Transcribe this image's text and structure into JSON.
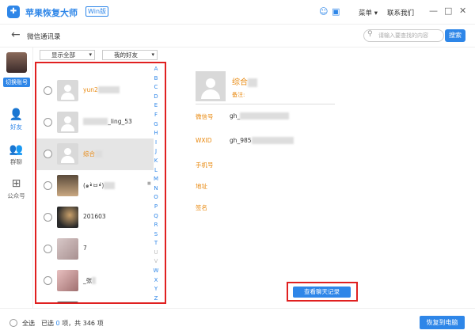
{
  "app": {
    "title": "苹果恢复大师",
    "edition": "Win版",
    "logo_glyph": "✚"
  },
  "titlebar": {
    "menu_label": "菜单",
    "menu_arrow": "▾",
    "contact_label": "联系我们",
    "min": "—",
    "max": "□",
    "close": "✕"
  },
  "nav": {
    "back": "←",
    "title": "微信通讯录"
  },
  "search": {
    "placeholder": "请输入要查找的内容",
    "button": "搜索"
  },
  "sidebar": {
    "switch_label": "切换账号",
    "items": [
      {
        "icon": "person-icon",
        "glyph": "👤",
        "label": "好友",
        "active": true
      },
      {
        "icon": "group-icon",
        "glyph": "👥",
        "label": "群聊",
        "active": false
      },
      {
        "icon": "grid-icon",
        "glyph": "⊞",
        "label": "公众号",
        "active": false
      }
    ]
  },
  "filters": {
    "show_all": "显示全部",
    "my_friends": "我的好友",
    "arrow": "▾"
  },
  "contacts": [
    {
      "name_prefix": "yun2",
      "name_hidden": "1xxxxx",
      "style": "orange"
    },
    {
      "name_prefix": "",
      "name_hidden": "xxxxxxx",
      "name_suffix": "_ling_53",
      "style": "normal"
    },
    {
      "name_prefix": "综合",
      "name_hidden": "xx",
      "style": "orange",
      "selected": true
    },
    {
      "name_prefix": "(๑•̀ㅂ•́)",
      "name_hidden": "xxx",
      "name_suffix": "",
      "style": "normal",
      "badge": "■"
    },
    {
      "name_prefix": "201603",
      "name_hidden": "",
      "style": "normal"
    },
    {
      "name_prefix": "7",
      "name_hidden": "",
      "style": "normal"
    },
    {
      "name_prefix": "_张",
      "name_hidden": "x",
      "style": "normal"
    }
  ],
  "alphabet": [
    "A",
    "B",
    "C",
    "D",
    "E",
    "F",
    "G",
    "H",
    "I",
    "J",
    "K",
    "L",
    "M",
    "N",
    "O",
    "P",
    "Q",
    "R",
    "S",
    "T",
    "U",
    "V",
    "W",
    "X",
    "Y",
    "Z"
  ],
  "alphabet_dim": [
    "U",
    "V"
  ],
  "detail": {
    "name_prefix": "综合",
    "remark_label": "备注:",
    "fields": [
      {
        "label": "微信号",
        "value": "gh_",
        "hidden": "xxxxxxxxxxxxxx"
      },
      {
        "label": "WXID",
        "value": "gh_985",
        "hidden": "xxxxxxxxxxxx"
      },
      {
        "label": "手机号",
        "value": ""
      },
      {
        "label": "地址",
        "value": ""
      },
      {
        "label": "签名",
        "value": ""
      }
    ],
    "chat_button": "查看聊天记录"
  },
  "footer": {
    "select_all": "全选",
    "selected_prefix": "已选",
    "selected_count": "0",
    "selected_mid": "项，共",
    "total": "346",
    "selected_suffix": "项",
    "recover_button": "恢复到电脑"
  },
  "colors": {
    "accent": "#2e86e8",
    "highlight": "#e8880e",
    "annotation": "#e02020"
  }
}
